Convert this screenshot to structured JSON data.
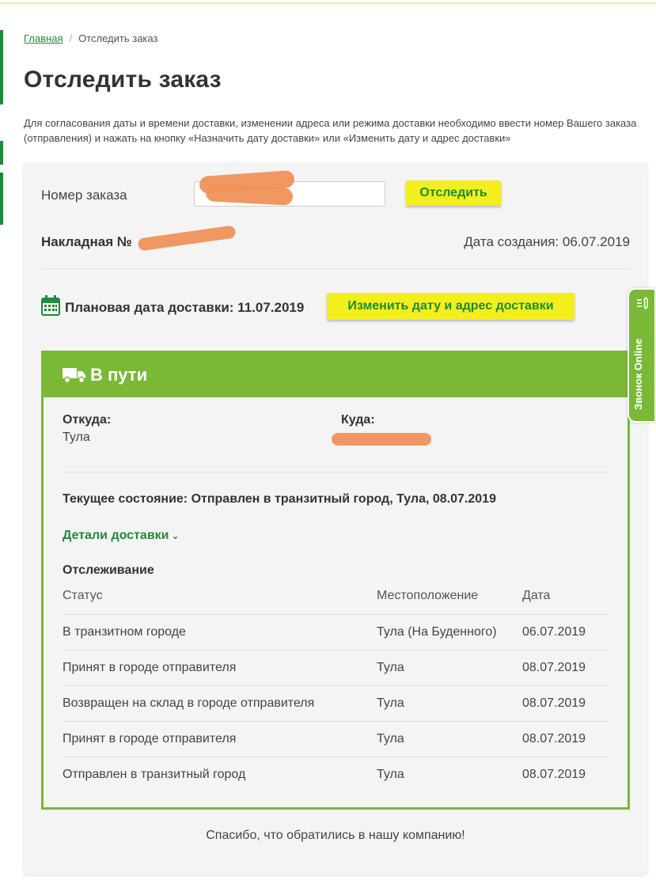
{
  "breadcrumb": {
    "home": "Главная",
    "separator": "/",
    "current": "Отследить заказ"
  },
  "page": {
    "title": "Отследить заказ",
    "intro": "Для согласования даты и времени доставки, изменении адреса или режима доставки необходимо ввести номер Вашего заказа (отправления) и нажать на кнопку «Назначить дату доставки» или «Изменить дату и адрес доставки»"
  },
  "order": {
    "label": "Номер заказа",
    "input_value": "",
    "track_button": "Отследить",
    "invoice_label": "Накладная №",
    "created": "Дата создания: 06.07.2019",
    "planned_date": "Плановая дата доставки: 11.07.2019",
    "change_button": "Изменить дату и адрес доставки"
  },
  "status": {
    "title": "В пути",
    "from_label": "Откуда:",
    "from_value": "Тула",
    "to_label": "Куда:",
    "current": "Текущее состояние: Отправлен в транзитный город, Тула, 08.07.2019",
    "details_link": "Детали доставки",
    "tracking_title": "Отслеживание",
    "columns": [
      "Статус",
      "Местоположение",
      "Дата"
    ],
    "rows": [
      [
        "В транзитном городе",
        "Тула (На Буденного)",
        "06.07.2019"
      ],
      [
        "Принят в городе отправителя",
        "Тула",
        "08.07.2019"
      ],
      [
        "Возвращен на склад в городе отправителя",
        "Тула",
        "08.07.2019"
      ],
      [
        "Принят в городе отправителя",
        "Тула",
        "08.07.2019"
      ],
      [
        "Отправлен в транзитный город",
        "Тула",
        "08.07.2019"
      ]
    ]
  },
  "footer": {
    "thanks": "Спасибо, что обратились в нашу компанию!"
  },
  "call_tab": {
    "label": "Звонок Online"
  },
  "colors": {
    "brand_green": "#1f8b3a",
    "status_green": "#79b935",
    "button_yellow": "#f3ef1c",
    "redaction": "#f0915a"
  },
  "icons": [
    "calendar-icon",
    "truck-icon",
    "chevron-down-icon",
    "phone-icon"
  ]
}
